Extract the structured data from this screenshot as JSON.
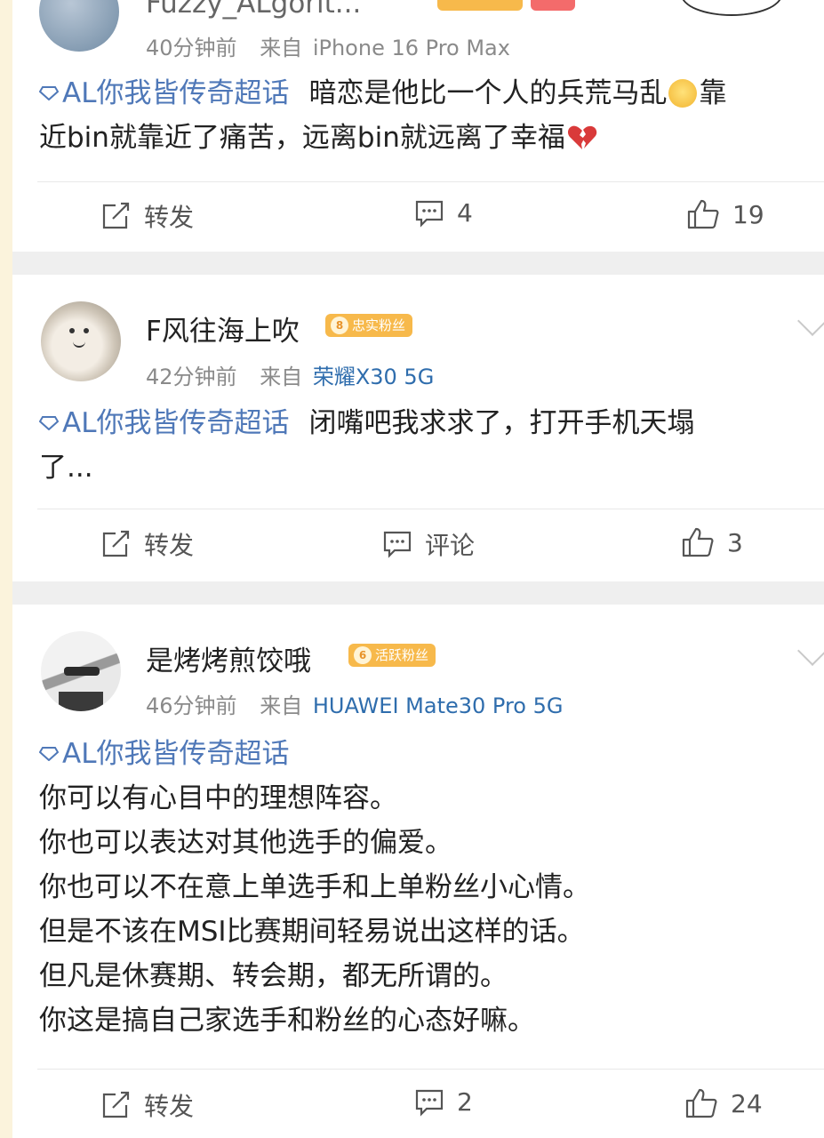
{
  "posts": [
    {
      "username": "Fuzzy_ALgorit...",
      "time": "40分钟前",
      "via": "来自",
      "source": "iPhone 16 Pro Max",
      "topic": "AL你我皆传奇超话",
      "text_line1": "暗恋是他比一个人的兵荒马乱",
      "text_line1b": "靠",
      "text_line2": "近bin就靠近了痛苦，远离bin就远离了幸福",
      "repost": "转发",
      "comments": "4",
      "likes": "19"
    },
    {
      "username": "F风往海上吹",
      "badge_level": "8",
      "badge_text": "忠实粉丝",
      "time": "42分钟前",
      "via": "来自",
      "source": "荣耀X30 5G",
      "topic": "AL你我皆传奇超话",
      "text_line1": "闭嘴吧我求求了，打开手机天塌",
      "text_line2": "了...",
      "repost": "转发",
      "comments": "评论",
      "likes": "3"
    },
    {
      "username": "是烤烤煎饺哦",
      "badge_level": "6",
      "badge_text": "活跃粉丝",
      "time": "46分钟前",
      "via": "来自",
      "source": "HUAWEI Mate30 Pro 5G",
      "topic": "AL你我皆传奇超话",
      "lines": [
        "你可以有心目中的理想阵容。",
        "你也可以表达对其他选手的偏爱。",
        "你也可以不在意上单选手和上单粉丝小心情。",
        "但是不该在MSI比赛期间轻易说出这样的话。",
        "但凡是休赛期、转会期，都无所谓的。",
        "你这是搞自己家选手和粉丝的心态好嘛。"
      ],
      "repost": "转发",
      "comments": "2",
      "likes": "24"
    }
  ],
  "colors": {
    "topic": "#4f78b8",
    "source_link": "#2f6dad",
    "badge": "#f7b94b"
  }
}
